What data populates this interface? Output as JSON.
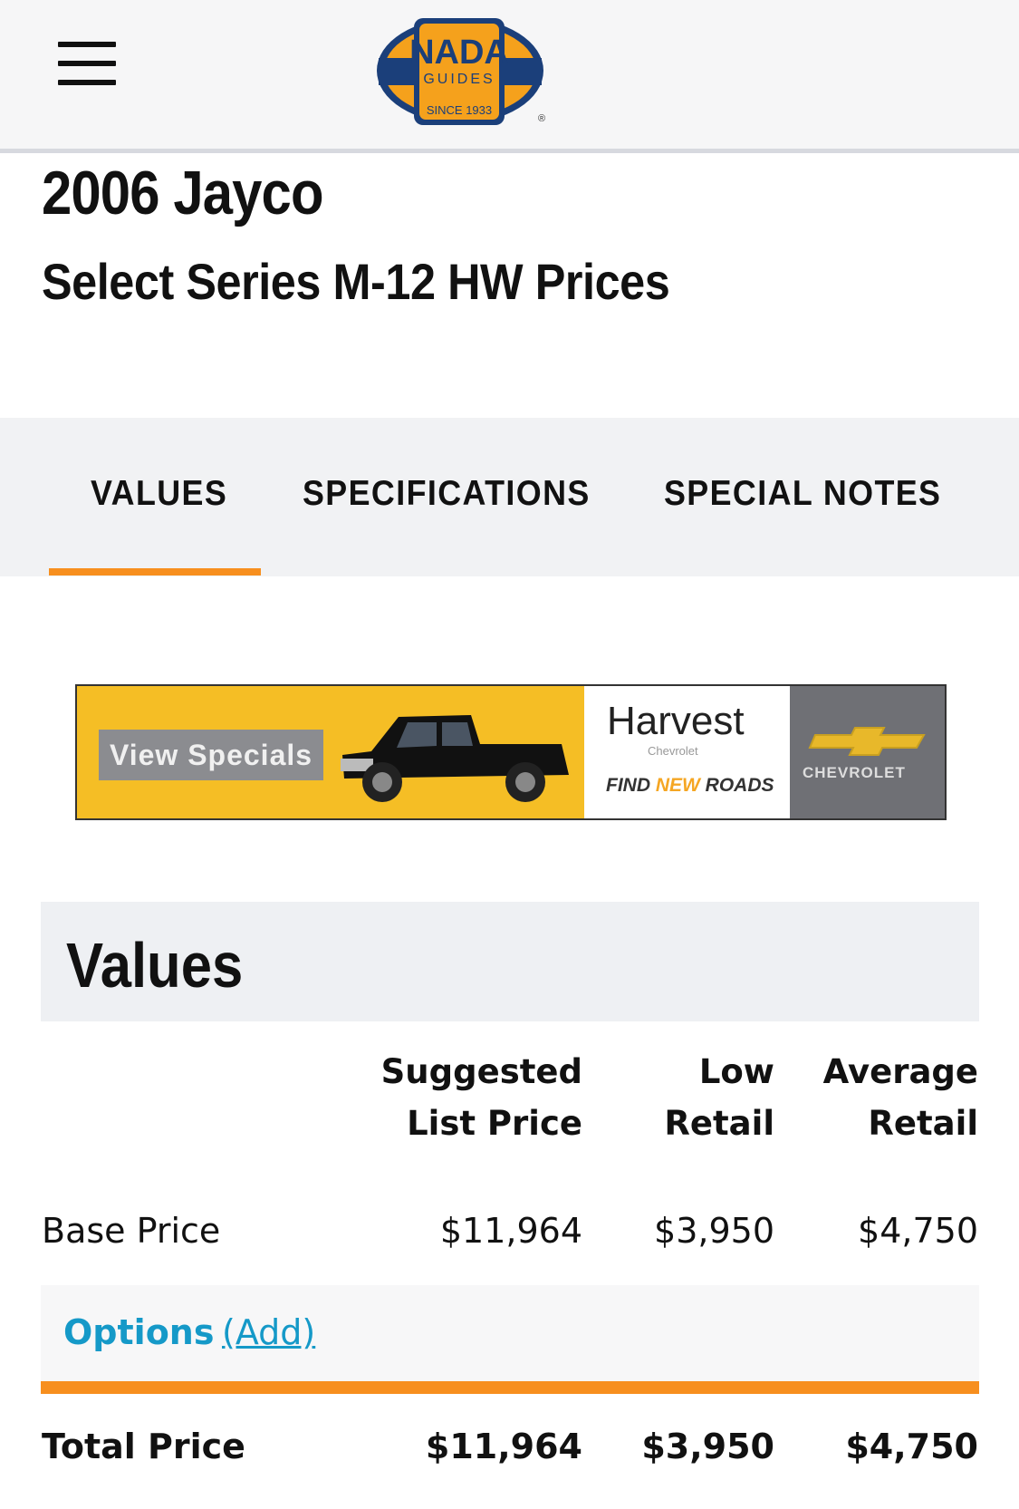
{
  "header": {
    "logo": {
      "brand": "NADA",
      "sub": "GUIDES",
      "since": "SINCE 1933",
      "reg": "®"
    }
  },
  "page": {
    "title": "2006 Jayco",
    "subtitle": "Select Series M-12 HW Prices"
  },
  "tabs": [
    {
      "label": "VALUES",
      "active": true
    },
    {
      "label": "SPECIFICATIONS",
      "active": false
    },
    {
      "label": "SPECIAL NOTES",
      "active": false
    }
  ],
  "ad": {
    "button": "View Specials",
    "dealer": "Harvest",
    "dealer_sub": "Chevrolet",
    "slogan_find": "FIND ",
    "slogan_new": "NEW",
    "slogan_roads": " ROADS",
    "brand": "CHEVROLET"
  },
  "values": {
    "heading": "Values",
    "columns": [
      {
        "line1": "Suggested",
        "line2": "List Price"
      },
      {
        "line1": "Low",
        "line2": "Retail"
      },
      {
        "line1": "Average",
        "line2": "Retail"
      }
    ],
    "base": {
      "label": "Base Price",
      "values": [
        "$11,964",
        "$3,950",
        "$4,750"
      ]
    },
    "options": {
      "label": "Options",
      "add": "(Add)"
    },
    "total": {
      "label": "Total Price",
      "values": [
        "$11,964",
        "$3,950",
        "$4,750"
      ]
    }
  },
  "colors": {
    "accent": "#f78f1e",
    "link": "#1599c8",
    "logo_blue": "#1b3f7a",
    "logo_orange": "#f5a11c"
  }
}
